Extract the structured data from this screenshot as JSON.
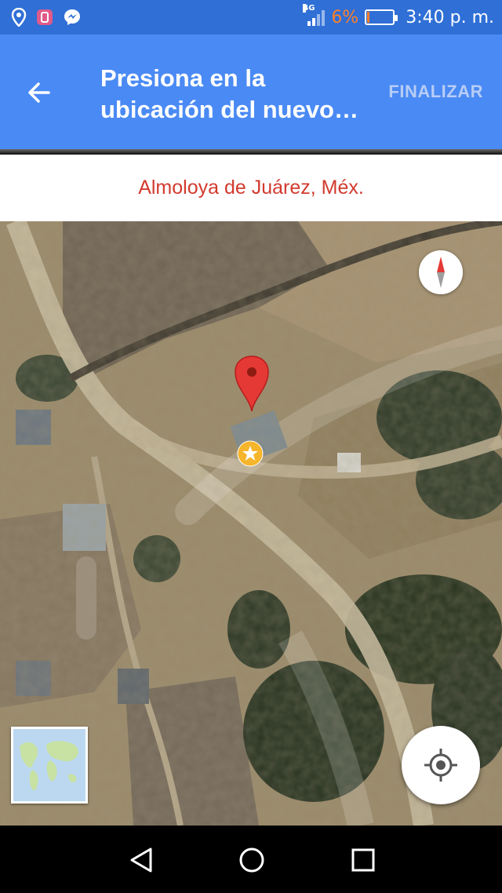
{
  "status_bar": {
    "time": "3:40 p. m.",
    "battery_percent": "6%",
    "battery_level": 0.06,
    "network_type": "4G",
    "notification_icons": [
      "location-pin-icon",
      "app-notification-icon",
      "messenger-icon"
    ],
    "battery_color": "#ff7f2a"
  },
  "app_bar": {
    "title": "Presiona en la ubicación del nuevo…",
    "back_icon": "arrow-left-icon",
    "action_label": "FINALIZAR",
    "color": "#4a8af4"
  },
  "address": {
    "text": "Almoloya de Juárez, Méx.",
    "color": "#d23a2e"
  },
  "map": {
    "view": "satellite",
    "pin_color": "#e53935",
    "star_marker_color": "#f6b52b",
    "compass_icon": "compass-icon",
    "locate_icon": "my-location-icon",
    "minimap_label": "world-map-thumbnail"
  },
  "nav_bar": {
    "buttons": [
      "back-triangle-icon",
      "home-circle-icon",
      "recents-square-icon"
    ]
  }
}
